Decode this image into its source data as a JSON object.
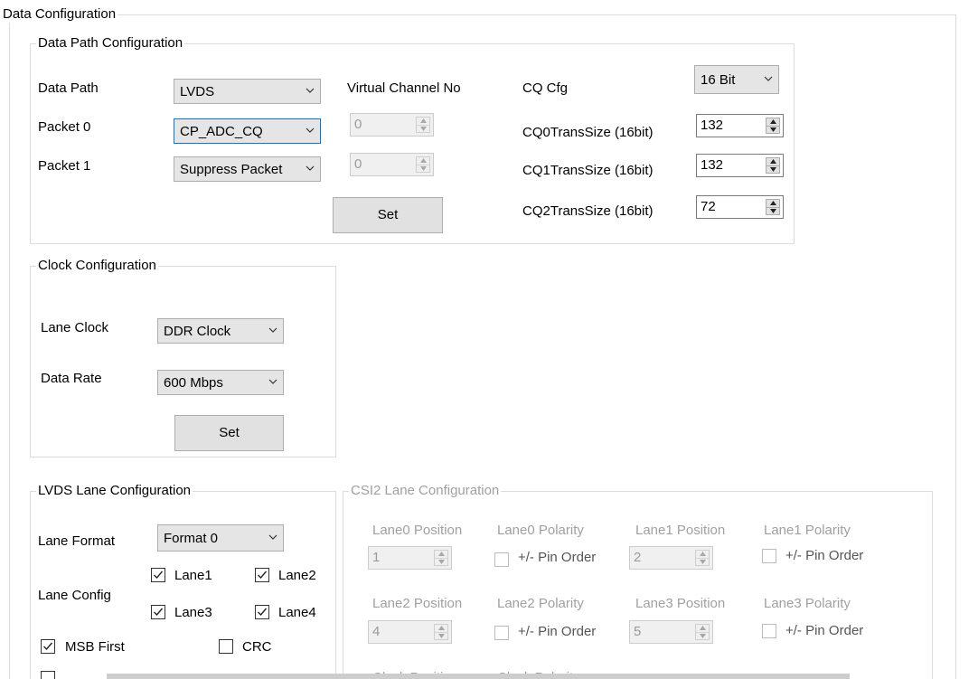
{
  "data_config": {
    "title": "Data Configuration"
  },
  "data_path": {
    "title": "Data Path Configuration",
    "data_path_label": "Data Path",
    "data_path_value": "LVDS",
    "packet0_label": "Packet 0",
    "packet0_value": "CP_ADC_CQ",
    "packet1_label": "Packet 1",
    "packet1_value": "Suppress Packet",
    "virtual_channel_label": "Virtual Channel No",
    "vc0_value": "0",
    "vc1_value": "0",
    "set_label": "Set",
    "cq_cfg_label": "CQ Cfg",
    "cq_cfg_value": "16 Bit",
    "cq0_label": "CQ0TransSize (16bit)",
    "cq0_value": "132",
    "cq1_label": "CQ1TransSize (16bit)",
    "cq1_value": "132",
    "cq2_label": "CQ2TransSize (16bit)",
    "cq2_value": "72"
  },
  "clock": {
    "title": "Clock Configuration",
    "lane_clock_label": "Lane Clock",
    "lane_clock_value": "DDR Clock",
    "data_rate_label": "Data Rate",
    "data_rate_value": "600 Mbps",
    "set_label": "Set"
  },
  "lvds": {
    "title": "LVDS Lane Configuration",
    "lane_format_label": "Lane Format",
    "lane_format_value": "Format 0",
    "lane_config_label": "Lane Config",
    "lane1_label": "Lane1",
    "lane2_label": "Lane2",
    "lane3_label": "Lane3",
    "lane4_label": "Lane4",
    "msb_first_label": "MSB First",
    "crc_label": "CRC"
  },
  "csi2": {
    "title": "CSI2 Lane Configuration",
    "lane0_position_label": "Lane0 Position",
    "lane0_position_value": "1",
    "lane0_polarity_label": "Lane0 Polarity",
    "lane1_position_label": "Lane1 Position",
    "lane1_position_value": "2",
    "lane1_polarity_label": "Lane1 Polarity",
    "lane2_position_label": "Lane2 Position",
    "lane2_position_value": "4",
    "lane2_polarity_label": "Lane2 Polarity",
    "lane3_position_label": "Lane3 Position",
    "lane3_position_value": "5",
    "lane3_polarity_label": "Lane3 Polarity",
    "pin_order_label": "+/- Pin Order",
    "clock_position_label": "Clock Position",
    "clock_polarity_label": "Clock Polarity"
  },
  "checkbox_states": {
    "lane1": true,
    "lane2": true,
    "lane3": true,
    "lane4": true,
    "msb_first": true,
    "crc": false,
    "lane0_polarity": false,
    "lane1_polarity": false,
    "lane2_polarity": false,
    "lane3_polarity": false
  },
  "icons": {
    "dropdown": "chevron-down-icon",
    "spinner": "spinner-arrows-icon",
    "checkbox": "checkmark-icon"
  },
  "colors": {
    "group_border": "#dcdcdc",
    "disabled_text": "#a0a0a0",
    "control_face": "#e1e1e1",
    "focus_border": "#0078d7"
  }
}
